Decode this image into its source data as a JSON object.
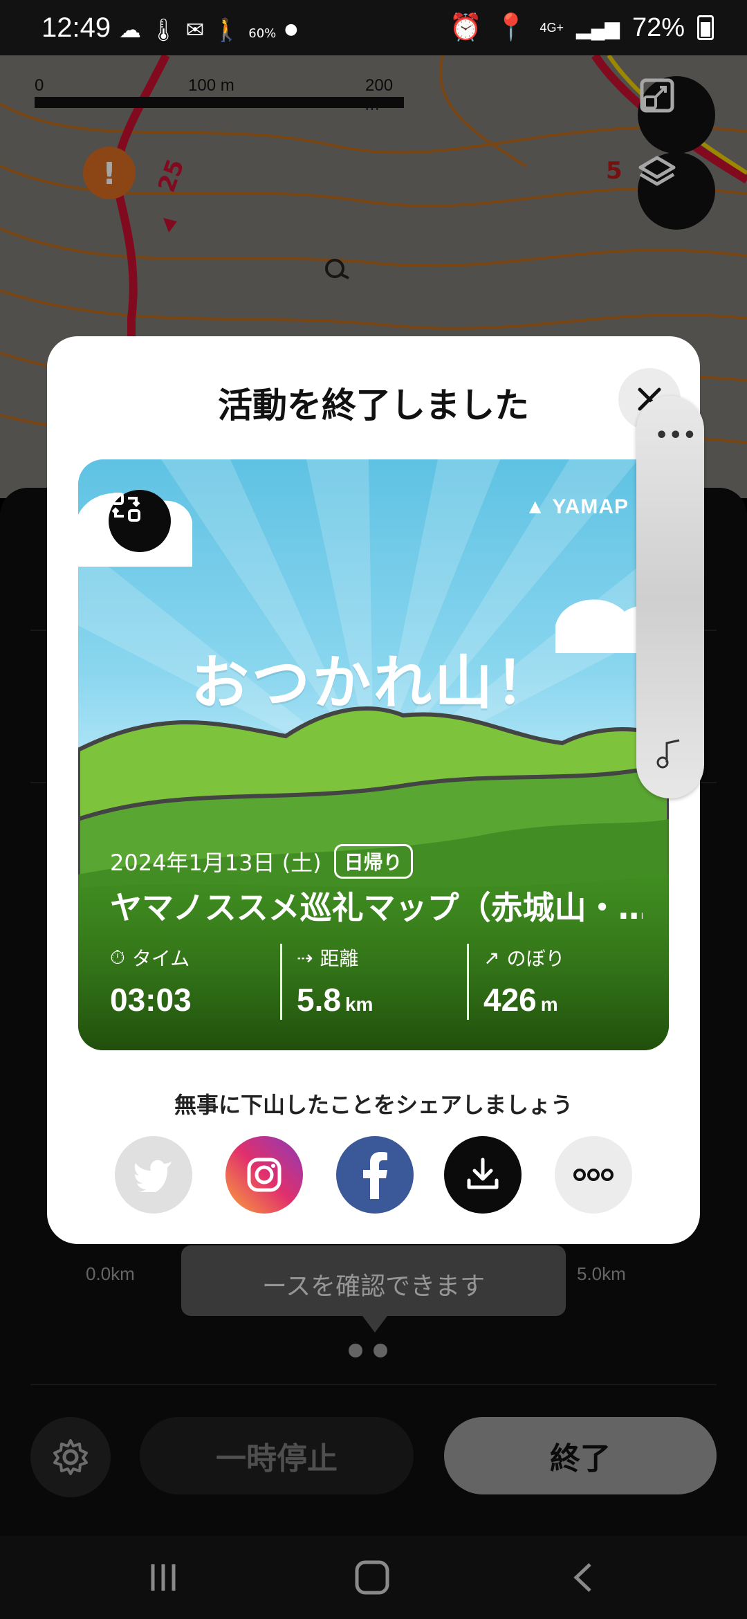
{
  "status_bar": {
    "time": "12:49",
    "left_icons": [
      "cloud-icon",
      "thermometer-icon",
      "mail-icon",
      "hiker-icon",
      "weather-humidity-icon"
    ],
    "humidity": "60%",
    "network": "4G+",
    "battery": "72%"
  },
  "map": {
    "scale_labels": [
      "0",
      "100 m",
      "200 m"
    ],
    "trail_marker": "25",
    "contour_marker": "5"
  },
  "modal": {
    "title": "活動を終了しました",
    "card": {
      "brand": "YAMAP",
      "hero_text": "おつかれ山！",
      "date": "2024年1月13日 (土)",
      "badge": "日帰り",
      "route_name": "ヤマノススメ巡礼マップ（赤城山・…",
      "stats": [
        {
          "label": "タイム",
          "value": "03:03",
          "unit": ""
        },
        {
          "label": "距離",
          "value": "5.8",
          "unit": "km"
        },
        {
          "label": "のぼり",
          "value": "426",
          "unit": "m"
        }
      ]
    },
    "share_prompt": "無事に下山したことをシェアしましょう"
  },
  "chart_axis": {
    "left": "0.0km",
    "right": "5.0km"
  },
  "tooltip": "ースを確認できます",
  "controls": {
    "pause_label": "一時停止",
    "finish_label": "終了"
  },
  "colors": {
    "trail_red": "#c8102e",
    "facebook_blue": "#3b5998",
    "twitter_disabled": "#e0e0e0"
  }
}
